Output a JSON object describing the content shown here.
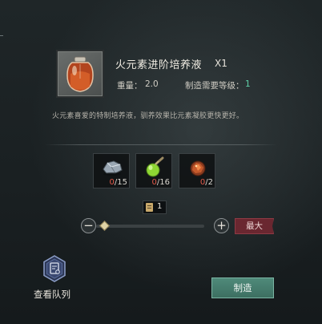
{
  "item": {
    "title": "火元素进阶培养液",
    "quantity": "X1",
    "weight_label": "重量：",
    "weight_value": "2.0",
    "level_req_label": "制造需要等级：",
    "level_req_value": "1",
    "description": "火元素喜爱的特制培养液，驯养效果比元素凝胶更快更好。"
  },
  "materials": [
    {
      "name": "silver-ore",
      "have": "0",
      "need": "/15"
    },
    {
      "name": "green-potion",
      "have": "0",
      "need": "/16"
    },
    {
      "name": "fire-crystal",
      "have": "0",
      "need": "/2"
    }
  ],
  "craft_count": {
    "value": "1"
  },
  "slider": {
    "min_symbol": "−",
    "max_symbol": "+",
    "level": 0.0
  },
  "buttons": {
    "max_label": "最大",
    "queue_label": "查看队列",
    "craft_label": "制造"
  },
  "colors": {
    "accent_green": "#5fd0a8",
    "insufficient_red": "#e35a4a",
    "craft_button": "#3d6f61",
    "max_button": "#6a2730"
  }
}
